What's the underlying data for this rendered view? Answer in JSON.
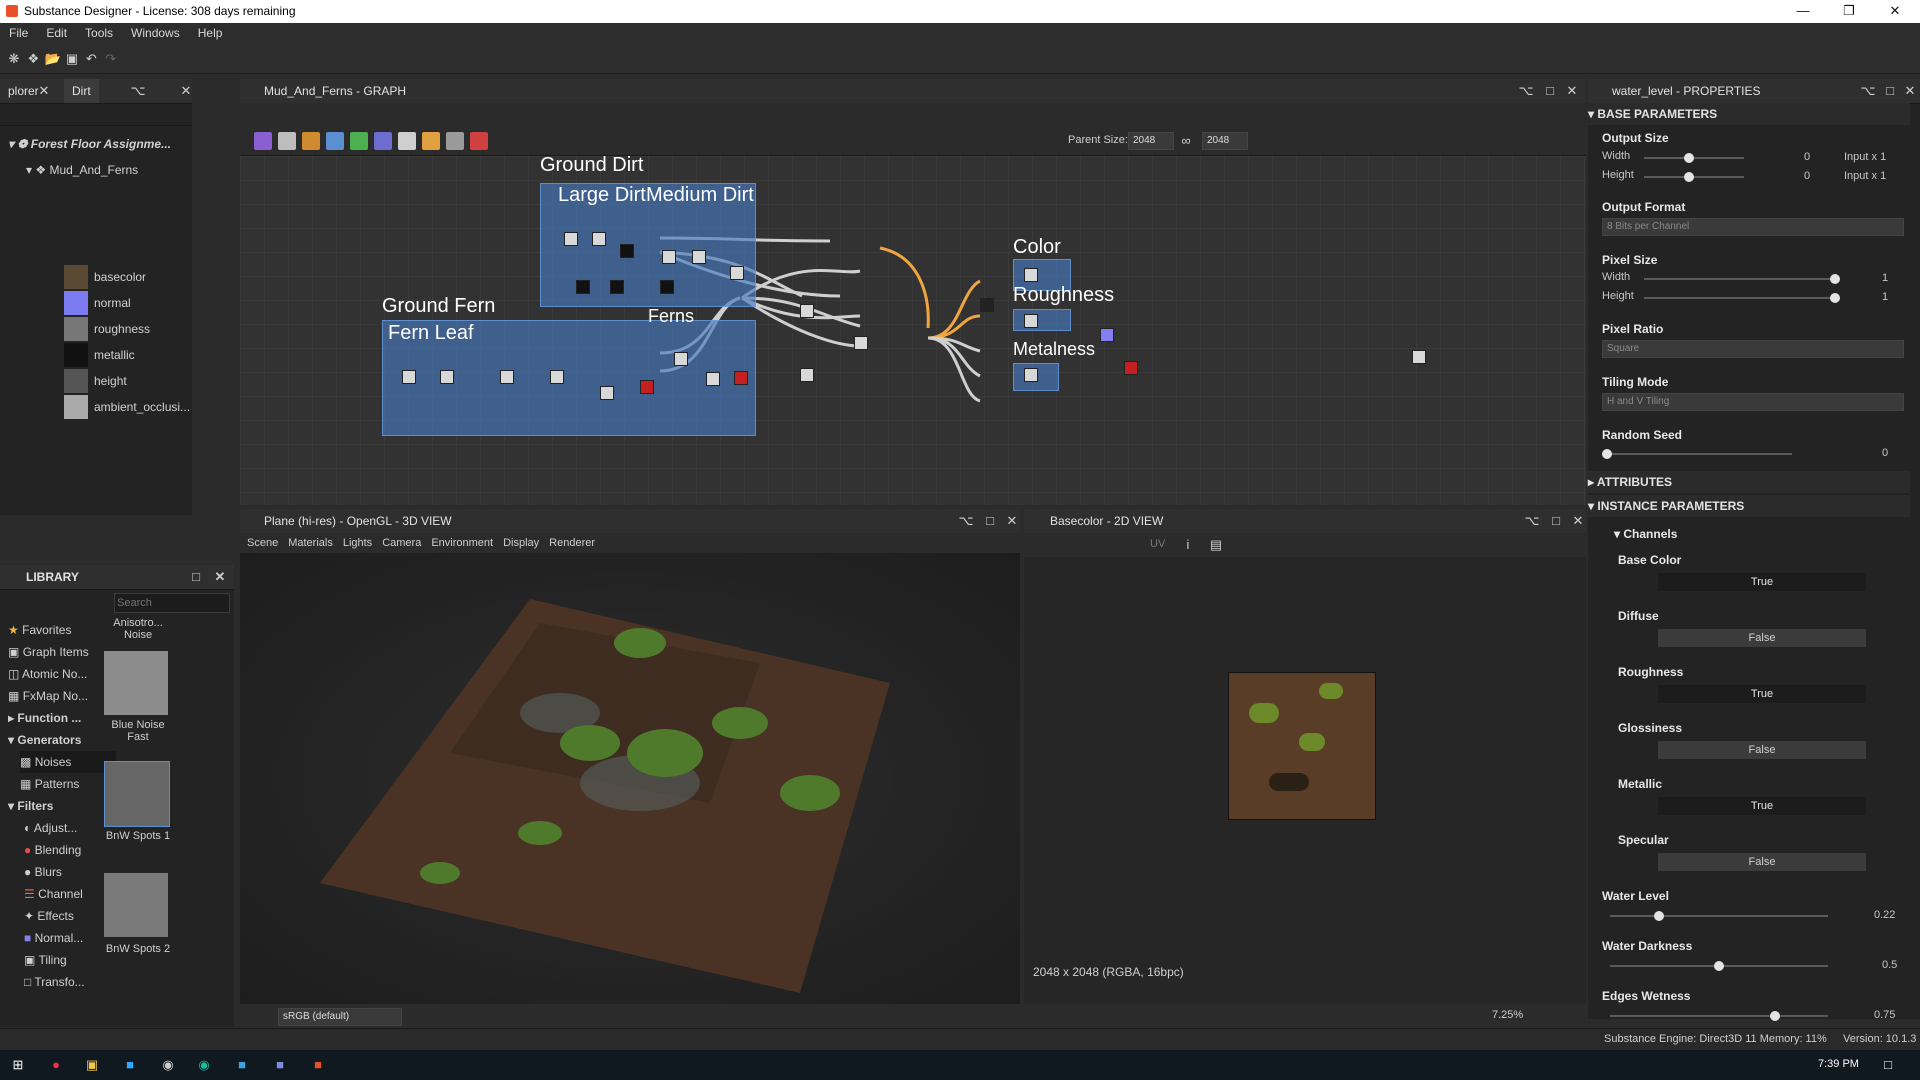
{
  "window": {
    "title": "Substance Designer - License: 308 days remaining"
  },
  "menu": [
    "File",
    "Edit",
    "Tools",
    "Windows",
    "Help"
  ],
  "explorer": {
    "tabs": [
      "plorer",
      "Dirt"
    ],
    "package": "Forest Floor Assignme...",
    "graph": "Mud_And_Ferns",
    "outputs": [
      "basecolor",
      "normal",
      "roughness",
      "metallic",
      "height",
      "ambient_occlusi..."
    ]
  },
  "graph_view": {
    "title": "Mud_And_Ferns - GRAPH",
    "parent_size_label": "Parent Size:",
    "parent_size_w": "2048",
    "parent_size_h": "2048",
    "frames": {
      "ground_dirt": "Ground Dirt",
      "large_dirt": "Large Dirt",
      "medium_dirt": "Medium Dirt",
      "ground_fern": "Ground Fern",
      "fern_leaf": "Fern Leaf",
      "ferns": "Ferns",
      "color": "Color",
      "roughness": "Roughness",
      "metalness": "Metalness"
    }
  },
  "library": {
    "title": "LIBRARY",
    "search_placeholder": "Search",
    "categories": [
      {
        "label": "Favorites",
        "icon": "star-icon"
      },
      {
        "label": "Graph Items",
        "icon": "graph-items-icon"
      },
      {
        "label": "Atomic No...",
        "icon": "atomic-icon"
      },
      {
        "label": "FxMap No...",
        "icon": "fxmap-icon"
      },
      {
        "label": "Function ...",
        "icon": "function-icon"
      },
      {
        "label": "Generators",
        "icon": "generators-icon"
      },
      {
        "label": "Noises",
        "icon": "noises-icon"
      },
      {
        "label": "Patterns",
        "icon": "patterns-icon"
      },
      {
        "label": "Filters",
        "icon": "filters-icon"
      },
      {
        "label": "Adjust...",
        "icon": "adjust-icon"
      },
      {
        "label": "Blending",
        "icon": "blending-icon"
      },
      {
        "label": "Blurs",
        "icon": "blurs-icon"
      },
      {
        "label": "Channel",
        "icon": "channel-icon"
      },
      {
        "label": "Effects",
        "icon": "effects-icon"
      },
      {
        "label": "Normal...",
        "icon": "normal-icon"
      },
      {
        "label": "Tiling",
        "icon": "tiling-icon"
      },
      {
        "label": "Transfo...",
        "icon": "transform-icon"
      }
    ],
    "items": [
      "Anisotro... Noise",
      "Blue Noise Fast",
      "BnW Spots 1",
      "BnW Spots 2"
    ]
  },
  "view3d": {
    "title": "Plane (hi-res) - OpenGL - 3D VIEW",
    "menu": [
      "Scene",
      "Materials",
      "Lights",
      "Camera",
      "Environment",
      "Display",
      "Renderer"
    ],
    "colorspace": "sRGB (default)"
  },
  "view2d": {
    "title": "Basecolor - 2D VIEW",
    "uv": "UV",
    "info": "2048 x 2048 (RGBA, 16bpc)",
    "zoom": "7.25%"
  },
  "properties": {
    "title": "water_level - PROPERTIES",
    "base_parameters": "BASE PARAMETERS",
    "output_size": "Output Size",
    "width": "Width",
    "height": "Height",
    "output_width_value": "0",
    "output_height_value": "0",
    "output_width_mode": "Input x 1",
    "output_height_mode": "Input x 1",
    "output_format": "Output Format",
    "output_format_value": "8 Bits per Channel",
    "pixel_size": "Pixel Size",
    "pixel_width_value": "1",
    "pixel_height_value": "1",
    "pixel_ratio": "Pixel Ratio",
    "pixel_ratio_value": "Square",
    "tiling_mode": "Tiling Mode",
    "tiling_mode_value": "H and V Tiling",
    "random_seed": "Random Seed",
    "random_seed_value": "0",
    "attributes": "ATTRIBUTES",
    "instance_parameters": "INSTANCE PARAMETERS",
    "channels": "Channels",
    "channel_list": [
      {
        "label": "Base Color",
        "value": "True"
      },
      {
        "label": "Diffuse",
        "value": "False"
      },
      {
        "label": "Roughness",
        "value": "True"
      },
      {
        "label": "Glossiness",
        "value": "False"
      },
      {
        "label": "Metallic",
        "value": "True"
      },
      {
        "label": "Specular",
        "value": "False"
      }
    ],
    "water_level": "Water Level",
    "water_level_value": "0.22",
    "water_darkness": "Water Darkness",
    "water_darkness_value": "0.5",
    "edges_wetness": "Edges Wetness",
    "edges_wetness_value": "0.75"
  },
  "status": {
    "engine": "Substance Engine: Direct3D 11  Memory: 11%",
    "version": "Version: 10.1.3"
  },
  "taskbar": {
    "time": "7:39 PM"
  },
  "colors": {
    "accent_blue": "#4a78be",
    "wire_orange": "#f0a540",
    "panel": "#232323"
  }
}
